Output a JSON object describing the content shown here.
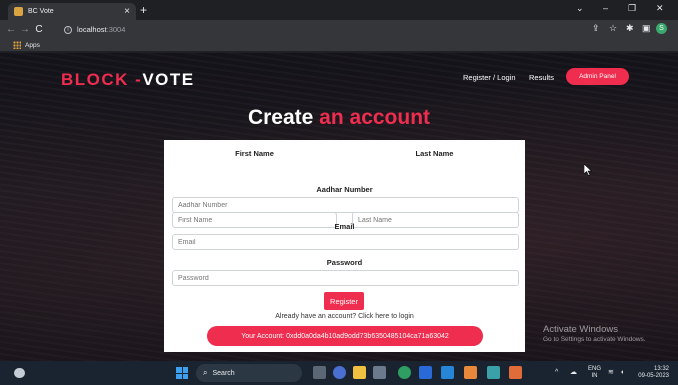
{
  "browser": {
    "tab_title": "BC Vote",
    "tab_close": "×",
    "new_tab": "+",
    "url_host": "localhost",
    "url_port": ":3004",
    "bookmarks_apps": "Apps",
    "window_controls": [
      "⌄",
      "–",
      "❐",
      "✕"
    ],
    "profile_initial": "S"
  },
  "site": {
    "logo_part1": "BLOCK -",
    "logo_part2": "VOTE",
    "nav": {
      "register_login": "Register / Login",
      "results": "Results",
      "admin_panel": "Admin Panel"
    },
    "heading_white": "Create ",
    "heading_red": "an account",
    "form": {
      "first_name_label": "First Name",
      "first_name_placeholder": "First Name",
      "last_name_label": "Last Name",
      "last_name_placeholder": "Last Name",
      "aadhar_label": "Aadhar Number",
      "aadhar_placeholder": "Aadhar Number",
      "email_label": "Email",
      "email_placeholder": "Email",
      "password_label": "Password",
      "password_placeholder": "Password",
      "register_button": "Register",
      "login_prompt": "Already have an account? Click here to login",
      "account_text": "Your Account: 0xdd0a0da4b10ad9odd73b6350485104ca71a63042"
    }
  },
  "watermark": {
    "title": "Activate Windows",
    "subtitle": "Go to Settings to activate Windows."
  },
  "taskbar": {
    "search_label": "Search",
    "language": "ENG",
    "region": "IN",
    "time": "13:32",
    "date": "09-05-2023"
  },
  "colors": {
    "accent": "#ee2d4f",
    "taskbar": "#1a2430"
  }
}
